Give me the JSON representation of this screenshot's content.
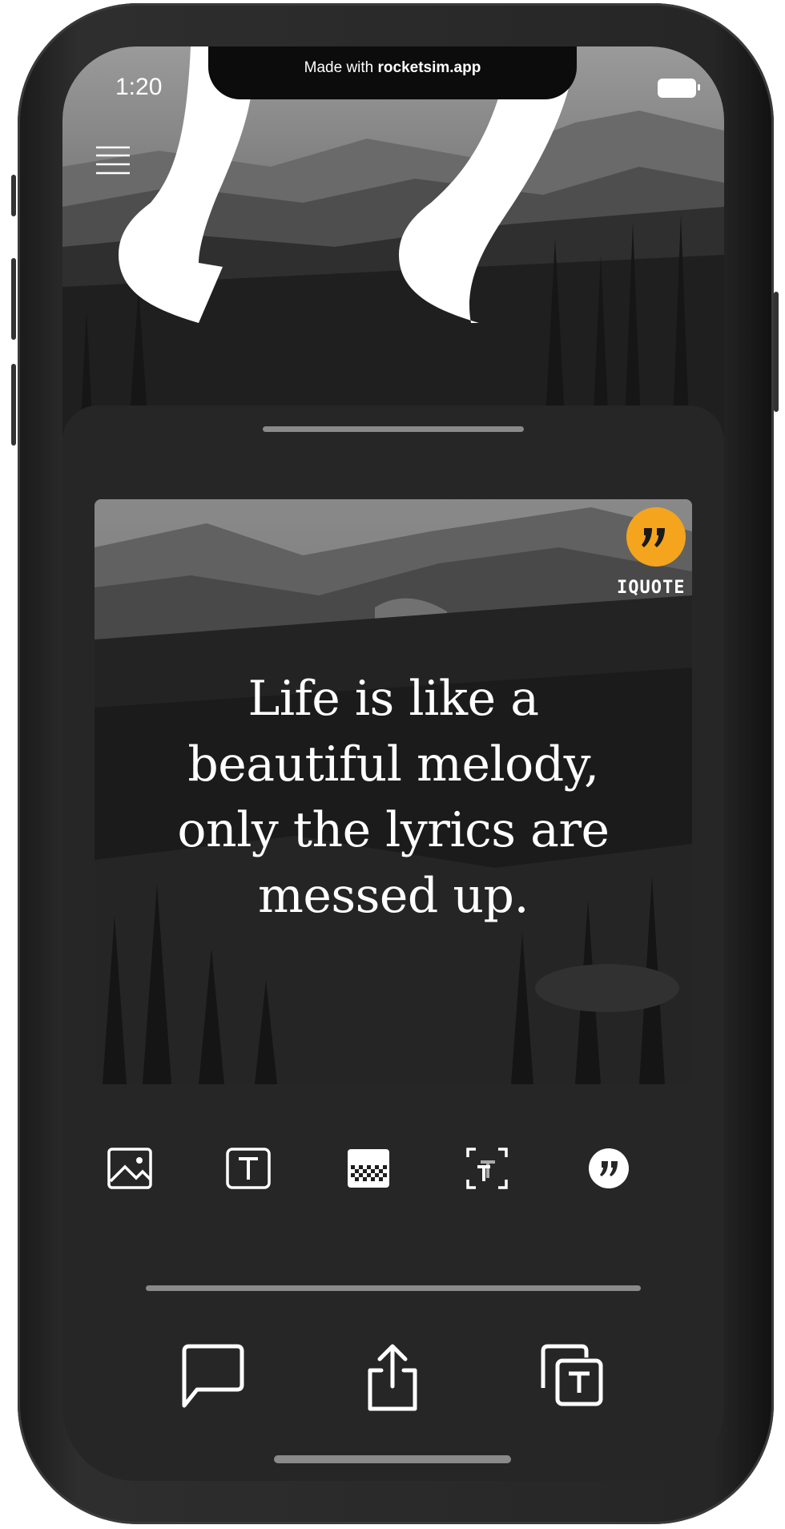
{
  "status_bar": {
    "time": "1:20",
    "notch_prefix": "Made with ",
    "notch_brand": "rocketsim.app"
  },
  "header": {
    "menu_icon": "hamburger-menu-icon",
    "decor_icon": "quotation-marks-icon"
  },
  "card": {
    "quote": "Life is like a beautiful melody, only the lyrics are messed up.",
    "logo_mark": "”",
    "logo_text": "IQUOTE",
    "accent_color": "#f4a51d"
  },
  "toolbar": {
    "tools": [
      {
        "name": "background-image",
        "icon": "image-icon"
      },
      {
        "name": "text-style",
        "icon": "text-icon"
      },
      {
        "name": "overlay-opacity",
        "icon": "opacity-pattern-icon"
      },
      {
        "name": "text-position",
        "icon": "text-frame-icon"
      },
      {
        "name": "watermark-logo",
        "icon": "quote-logo-icon"
      }
    ]
  },
  "actions": [
    {
      "name": "comment",
      "icon": "speech-bubble-icon"
    },
    {
      "name": "share",
      "icon": "share-icon"
    },
    {
      "name": "copy-text",
      "icon": "copy-text-icon"
    }
  ],
  "theme": {
    "sheet_background": "#262626",
    "handle_color": "#8a8a8a"
  }
}
